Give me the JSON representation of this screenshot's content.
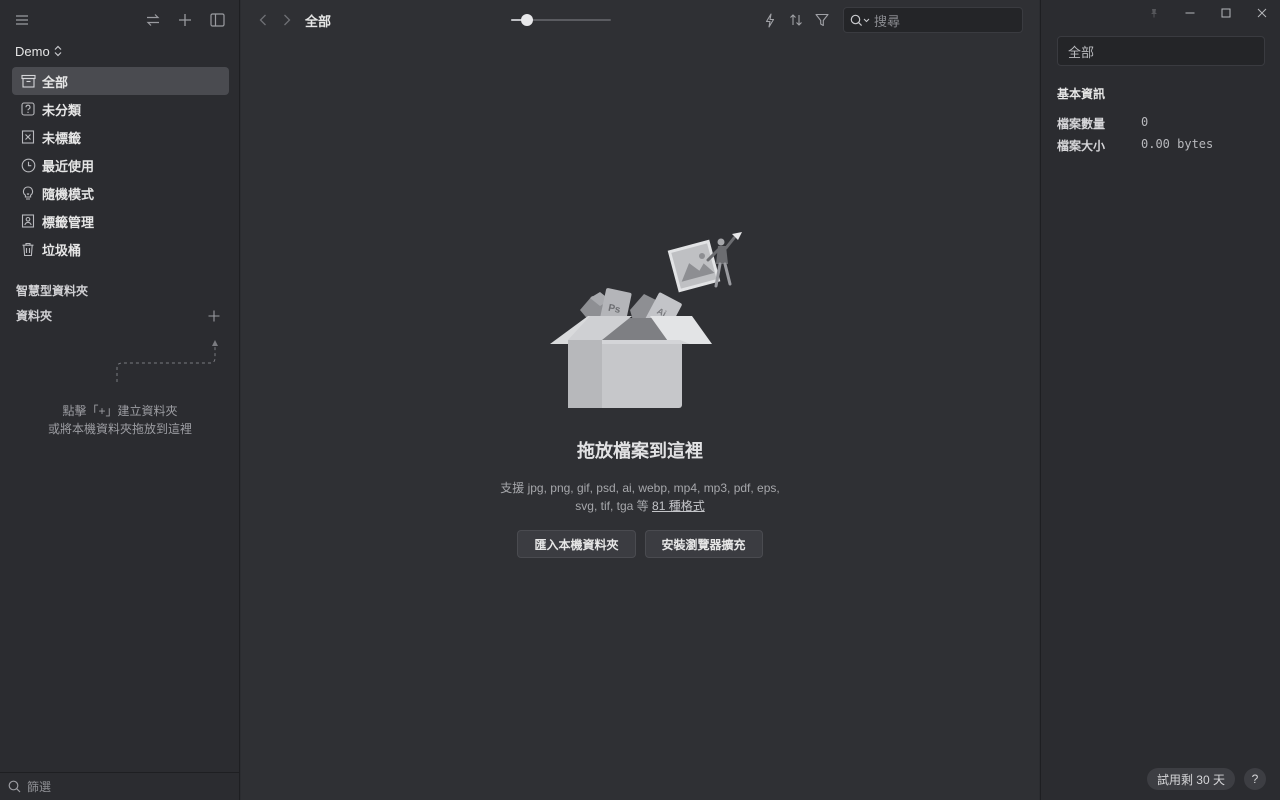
{
  "sidebar": {
    "library_name": "Demo",
    "nav": [
      {
        "label": "全部",
        "icon": "archive-icon",
        "active": true
      },
      {
        "label": "未分類",
        "icon": "question-box-icon"
      },
      {
        "label": "未標籤",
        "icon": "untagged-icon"
      },
      {
        "label": "最近使用",
        "icon": "clock-icon"
      },
      {
        "label": "隨機模式",
        "icon": "lightbulb-icon"
      },
      {
        "label": "標籤管理",
        "icon": "tag-manage-icon"
      },
      {
        "label": "垃圾桶",
        "icon": "trash-icon"
      }
    ],
    "smart_folders_label": "智慧型資料夾",
    "folders_label": "資料夾",
    "folder_hint_line1": "點擊「+」建立資料夾",
    "folder_hint_line2": "或將本機資料夾拖放到這裡",
    "filter_placeholder": "篩選"
  },
  "main": {
    "breadcrumb": "全部",
    "zoom_level": 0.15,
    "search_placeholder": "搜尋",
    "empty_title": "拖放檔案到這裡",
    "empty_desc_line1": "支援 jpg, png, gif, psd, ai, webp, mp4, mp3, pdf, eps,",
    "empty_desc_line2_prefix": "svg, tif, tga 等",
    "empty_desc_link": "81 種格式",
    "import_button": "匯入本機資料夾",
    "extension_button": "安裝瀏覽器擴充"
  },
  "inspector": {
    "name_value": "全部",
    "info_title": "基本資訊",
    "file_count_label": "檔案數量",
    "file_count_value": "0",
    "file_size_label": "檔案大小",
    "file_size_value": "0.00 bytes",
    "trial_label": "試用剩 30 天",
    "help_label": "?"
  }
}
